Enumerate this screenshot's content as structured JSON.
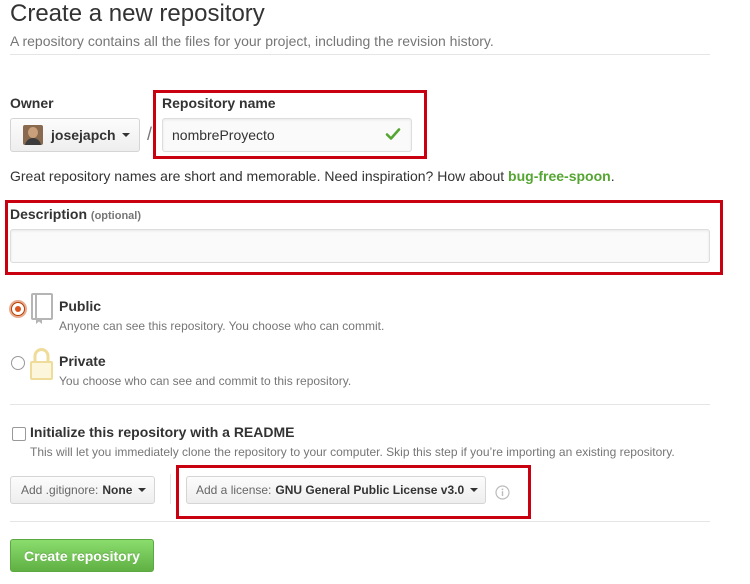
{
  "header": {
    "title": "Create a new repository",
    "subtitle": "A repository contains all the files for your project, including the revision history."
  },
  "owner": {
    "label": "Owner",
    "username": "josejapch"
  },
  "repo": {
    "label": "Repository name",
    "value": "nombreProyecto",
    "hint_prefix": "Great repository names are short and memorable. Need inspiration? How about ",
    "hint_suggestion": "bug-free-spoon",
    "hint_suffix": "."
  },
  "description": {
    "label": "Description",
    "optional": "(optional)",
    "value": ""
  },
  "visibility": {
    "public_title": "Public",
    "public_desc": "Anyone can see this repository. You choose who can commit.",
    "private_title": "Private",
    "private_desc": "You choose who can see and commit to this repository.",
    "selected": "public"
  },
  "init": {
    "label": "Initialize this repository with a README",
    "desc": "This will let you immediately clone the repository to your computer. Skip this step if you’re importing an existing repository.",
    "checked": false
  },
  "gitignore": {
    "label": "Add .gitignore:",
    "value": "None"
  },
  "license": {
    "label": "Add a license:",
    "value": "GNU General Public License v3.0"
  },
  "submit": {
    "label": "Create repository"
  },
  "colors": {
    "highlight": "#c8000f",
    "green": "#55a532",
    "radio_selected": "#d9531e"
  },
  "icons": {
    "check": "checkmark-icon",
    "public": "repo-book-icon",
    "private": "lock-icon",
    "info": "info-icon",
    "caret": "caret-down-icon"
  }
}
